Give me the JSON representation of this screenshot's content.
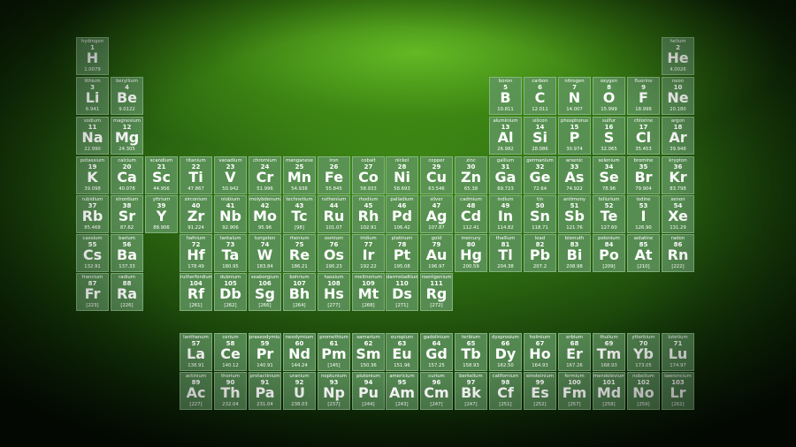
{
  "colors": {
    "cell_fill": "#5f965f",
    "cell_border": "#b9e1b4",
    "text": "#ffffff",
    "background": "#2a6410"
  },
  "elements": [
    {
      "n": "hydrogen",
      "z": "1",
      "s": "H",
      "m": "1.0079",
      "g": 1,
      "p": 1
    },
    {
      "n": "helium",
      "z": "2",
      "s": "He",
      "m": "4.0026",
      "g": 18,
      "p": 1
    },
    {
      "n": "lithium",
      "z": "3",
      "s": "Li",
      "m": "6.941",
      "g": 1,
      "p": 2
    },
    {
      "n": "beryllium",
      "z": "4",
      "s": "Be",
      "m": "9.0122",
      "g": 2,
      "p": 2
    },
    {
      "n": "boron",
      "z": "5",
      "s": "B",
      "m": "10.811",
      "g": 13,
      "p": 2
    },
    {
      "n": "carbon",
      "z": "6",
      "s": "C",
      "m": "12.011",
      "g": 14,
      "p": 2
    },
    {
      "n": "nitrogen",
      "z": "7",
      "s": "N",
      "m": "14.007",
      "g": 15,
      "p": 2
    },
    {
      "n": "oxygen",
      "z": "8",
      "s": "O",
      "m": "15.999",
      "g": 16,
      "p": 2
    },
    {
      "n": "fluorine",
      "z": "9",
      "s": "F",
      "m": "18.998",
      "g": 17,
      "p": 2
    },
    {
      "n": "neon",
      "z": "10",
      "s": "Ne",
      "m": "20.180",
      "g": 18,
      "p": 2
    },
    {
      "n": "sodium",
      "z": "11",
      "s": "Na",
      "m": "22.990",
      "g": 1,
      "p": 3
    },
    {
      "n": "magnesium",
      "z": "12",
      "s": "Mg",
      "m": "24.305",
      "g": 2,
      "p": 3
    },
    {
      "n": "aluminium",
      "z": "13",
      "s": "Al",
      "m": "26.982",
      "g": 13,
      "p": 3
    },
    {
      "n": "silicon",
      "z": "14",
      "s": "Si",
      "m": "28.086",
      "g": 14,
      "p": 3
    },
    {
      "n": "phosphorus",
      "z": "15",
      "s": "P",
      "m": "30.974",
      "g": 15,
      "p": 3
    },
    {
      "n": "sulfur",
      "z": "16",
      "s": "S",
      "m": "32.065",
      "g": 16,
      "p": 3
    },
    {
      "n": "chlorine",
      "z": "17",
      "s": "Cl",
      "m": "35.453",
      "g": 17,
      "p": 3
    },
    {
      "n": "argon",
      "z": "18",
      "s": "Ar",
      "m": "39.948",
      "g": 18,
      "p": 3
    },
    {
      "n": "potassium",
      "z": "19",
      "s": "K",
      "m": "39.098",
      "g": 1,
      "p": 4
    },
    {
      "n": "calcium",
      "z": "20",
      "s": "Ca",
      "m": "40.078",
      "g": 2,
      "p": 4
    },
    {
      "n": "scandium",
      "z": "21",
      "s": "Sc",
      "m": "44.956",
      "g": 3,
      "p": 4
    },
    {
      "n": "titanium",
      "z": "22",
      "s": "Ti",
      "m": "47.867",
      "g": 4,
      "p": 4
    },
    {
      "n": "vanadium",
      "z": "23",
      "s": "V",
      "m": "50.942",
      "g": 5,
      "p": 4
    },
    {
      "n": "chromium",
      "z": "24",
      "s": "Cr",
      "m": "51.996",
      "g": 6,
      "p": 4
    },
    {
      "n": "manganese",
      "z": "25",
      "s": "Mn",
      "m": "54.938",
      "g": 7,
      "p": 4
    },
    {
      "n": "iron",
      "z": "26",
      "s": "Fe",
      "m": "55.845",
      "g": 8,
      "p": 4
    },
    {
      "n": "cobalt",
      "z": "27",
      "s": "Co",
      "m": "58.933",
      "g": 9,
      "p": 4
    },
    {
      "n": "nickel",
      "z": "28",
      "s": "Ni",
      "m": "58.693",
      "g": 10,
      "p": 4
    },
    {
      "n": "copper",
      "z": "29",
      "s": "Cu",
      "m": "63.546",
      "g": 11,
      "p": 4
    },
    {
      "n": "zinc",
      "z": "30",
      "s": "Zn",
      "m": "65.38",
      "g": 12,
      "p": 4
    },
    {
      "n": "gallium",
      "z": "31",
      "s": "Ga",
      "m": "69.723",
      "g": 13,
      "p": 4
    },
    {
      "n": "germanium",
      "z": "32",
      "s": "Ge",
      "m": "72.64",
      "g": 14,
      "p": 4
    },
    {
      "n": "arsenic",
      "z": "33",
      "s": "As",
      "m": "74.922",
      "g": 15,
      "p": 4
    },
    {
      "n": "selenium",
      "z": "34",
      "s": "Se",
      "m": "78.96",
      "g": 16,
      "p": 4
    },
    {
      "n": "bromine",
      "z": "35",
      "s": "Br",
      "m": "79.904",
      "g": 17,
      "p": 4
    },
    {
      "n": "krypton",
      "z": "36",
      "s": "Kr",
      "m": "83.798",
      "g": 18,
      "p": 4
    },
    {
      "n": "rubidium",
      "z": "37",
      "s": "Rb",
      "m": "85.468",
      "g": 1,
      "p": 5
    },
    {
      "n": "strontium",
      "z": "38",
      "s": "Sr",
      "m": "87.62",
      "g": 2,
      "p": 5
    },
    {
      "n": "yttrium",
      "z": "39",
      "s": "Y",
      "m": "88.906",
      "g": 3,
      "p": 5
    },
    {
      "n": "zirconium",
      "z": "40",
      "s": "Zr",
      "m": "91.224",
      "g": 4,
      "p": 5
    },
    {
      "n": "niobium",
      "z": "41",
      "s": "Nb",
      "m": "92.906",
      "g": 5,
      "p": 5
    },
    {
      "n": "molybdenum",
      "z": "42",
      "s": "Mo",
      "m": "95.96",
      "g": 6,
      "p": 5
    },
    {
      "n": "technetium",
      "z": "43",
      "s": "Tc",
      "m": "[98]",
      "g": 7,
      "p": 5
    },
    {
      "n": "ruthenium",
      "z": "44",
      "s": "Ru",
      "m": "101.07",
      "g": 8,
      "p": 5
    },
    {
      "n": "rhodium",
      "z": "45",
      "s": "Rh",
      "m": "102.91",
      "g": 9,
      "p": 5
    },
    {
      "n": "palladium",
      "z": "46",
      "s": "Pd",
      "m": "106.42",
      "g": 10,
      "p": 5
    },
    {
      "n": "silver",
      "z": "47",
      "s": "Ag",
      "m": "107.87",
      "g": 11,
      "p": 5
    },
    {
      "n": "cadmium",
      "z": "48",
      "s": "Cd",
      "m": "112.41",
      "g": 12,
      "p": 5
    },
    {
      "n": "indium",
      "z": "49",
      "s": "In",
      "m": "114.82",
      "g": 13,
      "p": 5
    },
    {
      "n": "tin",
      "z": "50",
      "s": "Sn",
      "m": "118.71",
      "g": 14,
      "p": 5
    },
    {
      "n": "antimony",
      "z": "51",
      "s": "Sb",
      "m": "121.76",
      "g": 15,
      "p": 5
    },
    {
      "n": "tellurium",
      "z": "52",
      "s": "Te",
      "m": "127.60",
      "g": 16,
      "p": 5
    },
    {
      "n": "iodine",
      "z": "53",
      "s": "I",
      "m": "126.90",
      "g": 17,
      "p": 5
    },
    {
      "n": "xenon",
      "z": "54",
      "s": "Xe",
      "m": "131.29",
      "g": 18,
      "p": 5
    },
    {
      "n": "caesium",
      "z": "55",
      "s": "Cs",
      "m": "132.91",
      "g": 1,
      "p": 6
    },
    {
      "n": "barium",
      "z": "56",
      "s": "Ba",
      "m": "137.33",
      "g": 2,
      "p": 6
    },
    {
      "n": "hafnium",
      "z": "72",
      "s": "Hf",
      "m": "178.49",
      "g": 4,
      "p": 6
    },
    {
      "n": "tantalum",
      "z": "73",
      "s": "Ta",
      "m": "180.95",
      "g": 5,
      "p": 6
    },
    {
      "n": "tungsten",
      "z": "74",
      "s": "W",
      "m": "183.84",
      "g": 6,
      "p": 6
    },
    {
      "n": "rhenium",
      "z": "75",
      "s": "Re",
      "m": "186.21",
      "g": 7,
      "p": 6
    },
    {
      "n": "osmium",
      "z": "76",
      "s": "Os",
      "m": "190.23",
      "g": 8,
      "p": 6
    },
    {
      "n": "iridium",
      "z": "77",
      "s": "Ir",
      "m": "192.22",
      "g": 9,
      "p": 6
    },
    {
      "n": "platinum",
      "z": "78",
      "s": "Pt",
      "m": "195.08",
      "g": 10,
      "p": 6
    },
    {
      "n": "gold",
      "z": "79",
      "s": "Au",
      "m": "196.97",
      "g": 11,
      "p": 6
    },
    {
      "n": "mercury",
      "z": "80",
      "s": "Hg",
      "m": "200.59",
      "g": 12,
      "p": 6
    },
    {
      "n": "thallium",
      "z": "81",
      "s": "Tl",
      "m": "204.38",
      "g": 13,
      "p": 6
    },
    {
      "n": "lead",
      "z": "82",
      "s": "Pb",
      "m": "207.2",
      "g": 14,
      "p": 6
    },
    {
      "n": "bismuth",
      "z": "83",
      "s": "Bi",
      "m": "208.98",
      "g": 15,
      "p": 6
    },
    {
      "n": "polonium",
      "z": "84",
      "s": "Po",
      "m": "[209]",
      "g": 16,
      "p": 6
    },
    {
      "n": "astatine",
      "z": "85",
      "s": "At",
      "m": "[210]",
      "g": 17,
      "p": 6
    },
    {
      "n": "radon",
      "z": "86",
      "s": "Rn",
      "m": "[222]",
      "g": 18,
      "p": 6
    },
    {
      "n": "francium",
      "z": "87",
      "s": "Fr",
      "m": "[223]",
      "g": 1,
      "p": 7
    },
    {
      "n": "radium",
      "z": "88",
      "s": "Ra",
      "m": "[226]",
      "g": 2,
      "p": 7
    },
    {
      "n": "rutherfordium",
      "z": "104",
      "s": "Rf",
      "m": "[261]",
      "g": 4,
      "p": 7
    },
    {
      "n": "dubnium",
      "z": "105",
      "s": "Db",
      "m": "[262]",
      "g": 5,
      "p": 7
    },
    {
      "n": "seaborgium",
      "z": "106",
      "s": "Sg",
      "m": "[266]",
      "g": 6,
      "p": 7
    },
    {
      "n": "bohrium",
      "z": "107",
      "s": "Bh",
      "m": "[264]",
      "g": 7,
      "p": 7
    },
    {
      "n": "hassium",
      "z": "108",
      "s": "Hs",
      "m": "[277]",
      "g": 8,
      "p": 7
    },
    {
      "n": "meitnerium",
      "z": "109",
      "s": "Mt",
      "m": "[268]",
      "g": 9,
      "p": 7
    },
    {
      "n": "darmstadtium",
      "z": "110",
      "s": "Ds",
      "m": "[271]",
      "g": 10,
      "p": 7
    },
    {
      "n": "roentgenium",
      "z": "111",
      "s": "Rg",
      "m": "[272]",
      "g": 11,
      "p": 7
    },
    {
      "n": "lanthanum",
      "z": "57",
      "s": "La",
      "m": "138.91",
      "g": 4,
      "p": 9
    },
    {
      "n": "cerium",
      "z": "58",
      "s": "Ce",
      "m": "140.12",
      "g": 5,
      "p": 9
    },
    {
      "n": "praseodymium",
      "z": "59",
      "s": "Pr",
      "m": "140.91",
      "g": 6,
      "p": 9
    },
    {
      "n": "neodymium",
      "z": "60",
      "s": "Nd",
      "m": "144.24",
      "g": 7,
      "p": 9
    },
    {
      "n": "promethium",
      "z": "61",
      "s": "Pm",
      "m": "[145]",
      "g": 8,
      "p": 9
    },
    {
      "n": "samarium",
      "z": "62",
      "s": "Sm",
      "m": "150.36",
      "g": 9,
      "p": 9
    },
    {
      "n": "europium",
      "z": "63",
      "s": "Eu",
      "m": "151.96",
      "g": 10,
      "p": 9
    },
    {
      "n": "gadolinium",
      "z": "64",
      "s": "Gd",
      "m": "157.25",
      "g": 11,
      "p": 9
    },
    {
      "n": "terbium",
      "z": "65",
      "s": "Tb",
      "m": "158.93",
      "g": 12,
      "p": 9
    },
    {
      "n": "dysprosium",
      "z": "66",
      "s": "Dy",
      "m": "162.50",
      "g": 13,
      "p": 9
    },
    {
      "n": "holmium",
      "z": "67",
      "s": "Ho",
      "m": "164.93",
      "g": 14,
      "p": 9
    },
    {
      "n": "erbium",
      "z": "68",
      "s": "Er",
      "m": "167.26",
      "g": 15,
      "p": 9
    },
    {
      "n": "thulium",
      "z": "69",
      "s": "Tm",
      "m": "168.93",
      "g": 16,
      "p": 9
    },
    {
      "n": "ytterbium",
      "z": "70",
      "s": "Yb",
      "m": "173.05",
      "g": 17,
      "p": 9
    },
    {
      "n": "lutetium",
      "z": "71",
      "s": "Lu",
      "m": "174.97",
      "g": 18,
      "p": 9
    },
    {
      "n": "actinium",
      "z": "89",
      "s": "Ac",
      "m": "[227]",
      "g": 4,
      "p": 10
    },
    {
      "n": "thorium",
      "z": "90",
      "s": "Th",
      "m": "232.04",
      "g": 5,
      "p": 10
    },
    {
      "n": "protactinium",
      "z": "91",
      "s": "Pa",
      "m": "231.04",
      "g": 6,
      "p": 10
    },
    {
      "n": "uranium",
      "z": "92",
      "s": "U",
      "m": "238.03",
      "g": 7,
      "p": 10
    },
    {
      "n": "neptunium",
      "z": "93",
      "s": "Np",
      "m": "[237]",
      "g": 8,
      "p": 10
    },
    {
      "n": "plutonium",
      "z": "94",
      "s": "Pu",
      "m": "[244]",
      "g": 9,
      "p": 10
    },
    {
      "n": "americium",
      "z": "95",
      "s": "Am",
      "m": "[243]",
      "g": 10,
      "p": 10
    },
    {
      "n": "curium",
      "z": "96",
      "s": "Cm",
      "m": "[247]",
      "g": 11,
      "p": 10
    },
    {
      "n": "berkelium",
      "z": "97",
      "s": "Bk",
      "m": "[247]",
      "g": 12,
      "p": 10
    },
    {
      "n": "californium",
      "z": "98",
      "s": "Cf",
      "m": "[251]",
      "g": 13,
      "p": 10
    },
    {
      "n": "einsteinium",
      "z": "99",
      "s": "Es",
      "m": "[252]",
      "g": 14,
      "p": 10
    },
    {
      "n": "fermium",
      "z": "100",
      "s": "Fm",
      "m": "[257]",
      "g": 15,
      "p": 10
    },
    {
      "n": "mendelevium",
      "z": "101",
      "s": "Md",
      "m": "[258]",
      "g": 16,
      "p": 10
    },
    {
      "n": "nobelium",
      "z": "102",
      "s": "No",
      "m": "[259]",
      "g": 17,
      "p": 10
    },
    {
      "n": "lawrencium",
      "z": "103",
      "s": "Lr",
      "m": "[262]",
      "g": 18,
      "p": 10
    }
  ]
}
